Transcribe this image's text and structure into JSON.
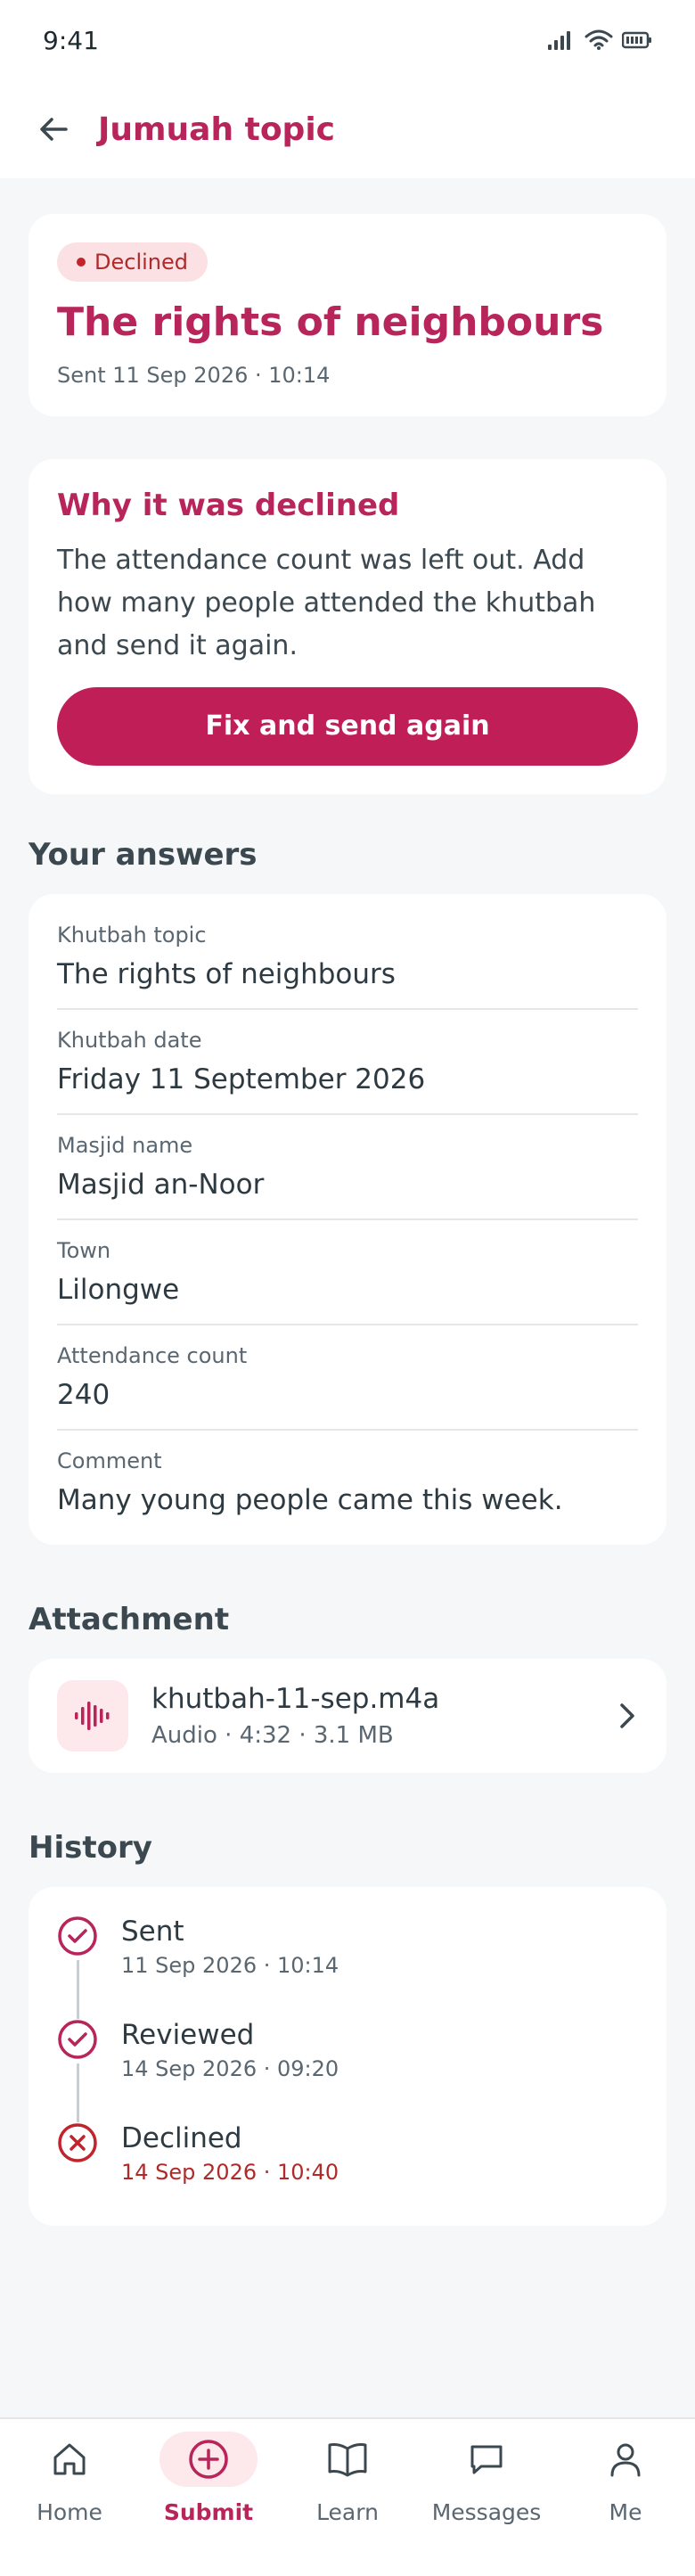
{
  "status_bar": {
    "time": "9:41"
  },
  "app_bar": {
    "title": "Jumuah topic"
  },
  "summary": {
    "badge": "Declined",
    "title": "The rights of neighbours",
    "sent": "Sent 11 Sep 2026 · 10:14"
  },
  "decline": {
    "heading": "Why it was declined",
    "text": "The attendance count was left out. Add how many people attended the khutbah and send it again.",
    "button": "Fix and send again"
  },
  "answers": {
    "heading": "Your answers",
    "items": [
      {
        "label": "Khutbah topic",
        "value": "The rights of neighbours"
      },
      {
        "label": "Khutbah date",
        "value": "Friday 11 September 2026"
      },
      {
        "label": "Masjid name",
        "value": "Masjid an-Noor"
      },
      {
        "label": "Town",
        "value": "Lilongwe"
      },
      {
        "label": "Attendance count",
        "value": "240"
      },
      {
        "label": "Comment",
        "value": "Many young people came this week."
      }
    ]
  },
  "attachment": {
    "heading": "Attachment",
    "name": "khutbah-11-sep.m4a",
    "meta": "Audio · 4:32 · 3.1 MB"
  },
  "history": {
    "heading": "History",
    "items": [
      {
        "title": "Sent",
        "time": "11 Sep 2026 · 10:14"
      },
      {
        "title": "Reviewed",
        "time": "14 Sep 2026 · 09:20"
      },
      {
        "title": "Declined",
        "time": "14 Sep 2026 · 10:40"
      }
    ]
  },
  "nav": {
    "items": [
      {
        "label": "Home",
        "icon": "home-icon"
      },
      {
        "label": "Submit",
        "icon": "plus-circle-icon"
      },
      {
        "label": "Learn",
        "icon": "book-icon"
      },
      {
        "label": "Messages",
        "icon": "chat-icon"
      },
      {
        "label": "Me",
        "icon": "person-icon"
      }
    ],
    "active": "Submit"
  },
  "colors": {
    "accent": "#b8255a",
    "button": "#bf1f56",
    "declined": "#b02a2a",
    "badge_bg": "#fbe1e3",
    "background": "#f5f7f9"
  }
}
